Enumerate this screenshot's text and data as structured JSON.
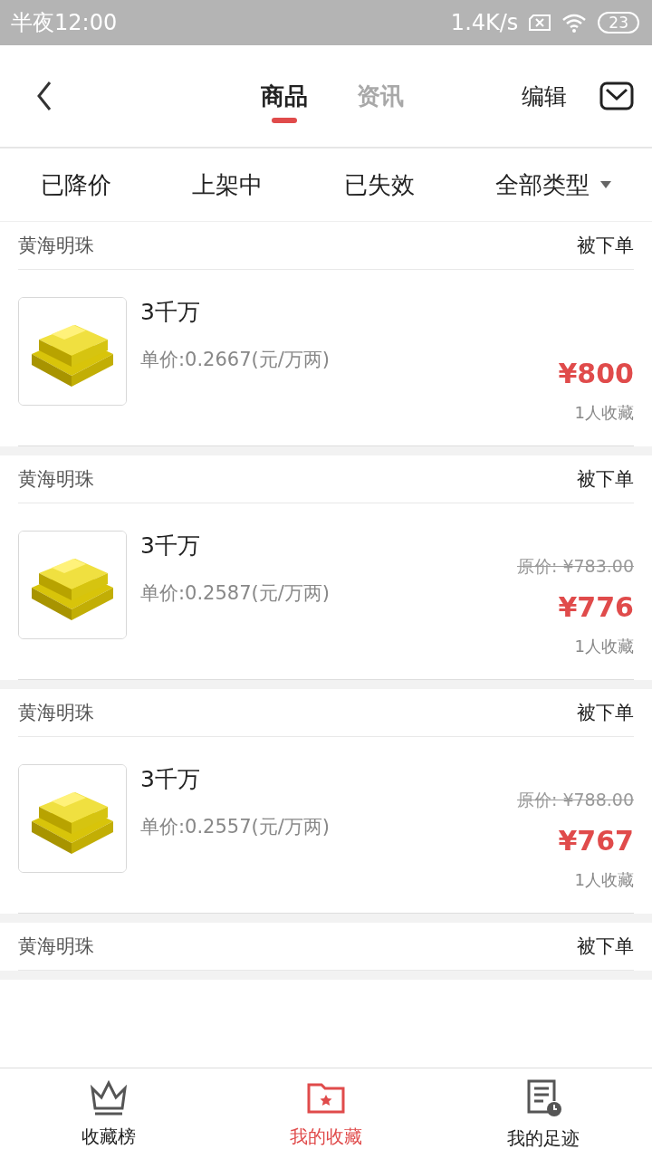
{
  "status_bar": {
    "time": "半夜12:00",
    "speed": "1.4K/s",
    "battery": "23"
  },
  "header": {
    "tabs": [
      {
        "label": "商品",
        "selected": true
      },
      {
        "label": "资讯",
        "selected": false
      }
    ],
    "edit": "编辑"
  },
  "filters": [
    {
      "label": "已降价",
      "dropdown": false
    },
    {
      "label": "上架中",
      "dropdown": false
    },
    {
      "label": "已失效",
      "dropdown": false
    },
    {
      "label": "全部类型",
      "dropdown": true
    }
  ],
  "items": [
    {
      "seller": "黄海明珠",
      "status": "被下单",
      "product": {
        "name": "3千万",
        "unit_price": "单价:0.2667(元/万两)",
        "price": "¥800",
        "favorites": "1人收藏"
      }
    },
    {
      "seller": "黄海明珠",
      "status": "被下单",
      "product": {
        "name": "3千万",
        "unit_price": "单价:0.2587(元/万两)",
        "original_price": "原价: ¥783.00",
        "price": "¥776",
        "favorites": "1人收藏"
      }
    },
    {
      "seller": "黄海明珠",
      "status": "被下单",
      "product": {
        "name": "3千万",
        "unit_price": "单价:0.2557(元/万两)",
        "original_price": "原价: ¥788.00",
        "price": "¥767",
        "favorites": "1人收藏"
      }
    },
    {
      "seller": "黄海明珠",
      "status": "被下单"
    }
  ],
  "bottom_nav": [
    {
      "label": "收藏榜",
      "kind": "crown",
      "selected": false
    },
    {
      "label": "我的收藏",
      "kind": "folder",
      "selected": true
    },
    {
      "label": "我的足迹",
      "kind": "history",
      "selected": false
    }
  ]
}
